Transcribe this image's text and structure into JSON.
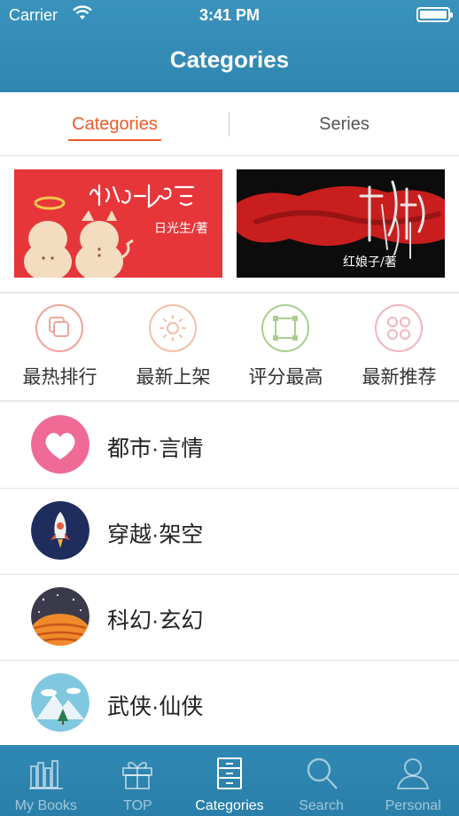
{
  "status": {
    "carrier": "Carrier",
    "time": "3:41 PM"
  },
  "nav": {
    "title": "Categories"
  },
  "segments": {
    "left": "Categories",
    "right": "Series"
  },
  "banners": [
    {
      "title_art": "kk·S·可言",
      "author": "日光生/著"
    },
    {
      "title_art": "红娘子",
      "author": "红娘子/著"
    }
  ],
  "quick": [
    {
      "label": "最热排行",
      "icon": "hot-rank-icon",
      "color": "#f0a39a"
    },
    {
      "label": "最新上架",
      "icon": "new-shelf-icon",
      "color": "#f3bfa7"
    },
    {
      "label": "评分最高",
      "icon": "top-rated-icon",
      "color": "#a9cf8e"
    },
    {
      "label": "最新推荐",
      "icon": "recommend-icon",
      "color": "#f0b6bd"
    }
  ],
  "categories": [
    {
      "label": "都市·言情",
      "icon": "heart-icon",
      "color": "#f06a96"
    },
    {
      "label": "穿越·架空",
      "icon": "rocket-icon",
      "color": "#1f2c5e"
    },
    {
      "label": "科幻·玄幻",
      "icon": "planet-icon",
      "color": "#3b3a4a"
    },
    {
      "label": "武侠·仙侠",
      "icon": "mountain-icon",
      "color": "#7fc8e0"
    }
  ],
  "tabbar": [
    {
      "label": "My Books",
      "icon": "bookshelf-icon"
    },
    {
      "label": "TOP",
      "icon": "gift-icon"
    },
    {
      "label": "Categories",
      "icon": "cabinet-icon",
      "active": true
    },
    {
      "label": "Search",
      "icon": "search-icon"
    },
    {
      "label": "Personal",
      "icon": "person-icon"
    }
  ]
}
